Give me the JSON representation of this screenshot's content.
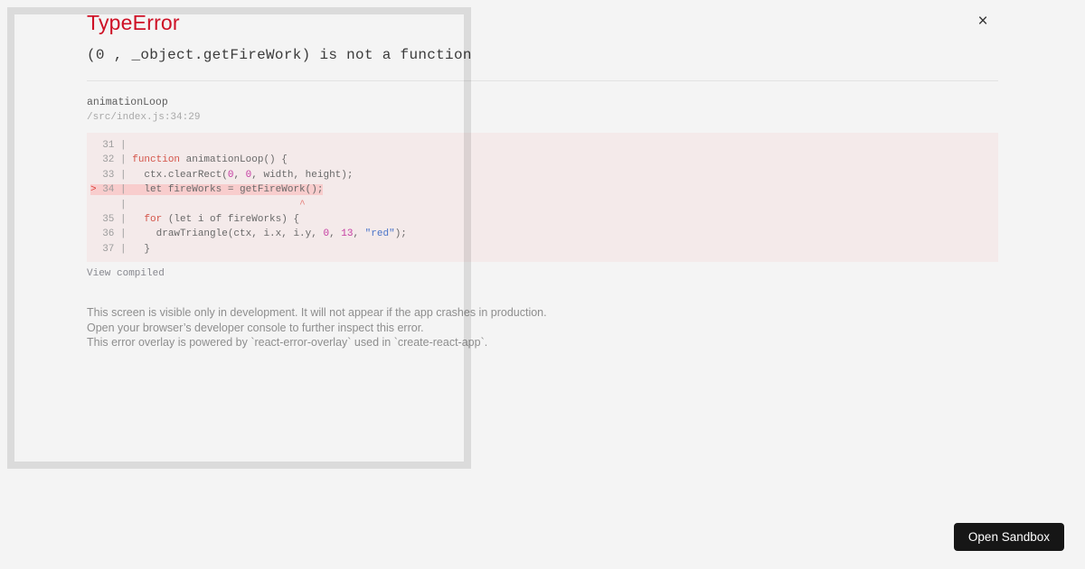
{
  "colors": {
    "page_bg": "#f4f4f4",
    "title_red": "#ce1126",
    "code_bg": "#f4eaea",
    "highlight_bg": "#f8cdcd",
    "keyword": "#d4554a",
    "number": "#c53ca2",
    "string": "#4a74c9",
    "button_bg": "#161616"
  },
  "overlay": {
    "title": "TypeError",
    "message": "(0 , _object.getFireWork) is not a function",
    "close_label": "×",
    "stack": {
      "function_name": "animationLoop",
      "file_location": "/src/index.js:34:29",
      "view_compiled": "View compiled"
    },
    "footer_lines": [
      "This screen is visible only in development. It will not appear if the app crashes in production.",
      "Open your browser’s developer console to further inspect this error.",
      "This error overlay is powered by `react-error-overlay` used in `create-react-app`."
    ]
  },
  "code_block": {
    "lines": [
      {
        "highlight": false,
        "tokens": [
          [
            "gutter",
            "  31 | "
          ]
        ]
      },
      {
        "highlight": false,
        "tokens": [
          [
            "gutter",
            "  32 | "
          ],
          [
            "keyword",
            "function"
          ],
          [
            "plain",
            " animationLoop() {"
          ]
        ]
      },
      {
        "highlight": false,
        "tokens": [
          [
            "gutter",
            "  33 | "
          ],
          [
            "plain",
            "  ctx.clearRect("
          ],
          [
            "number",
            "0"
          ],
          [
            "plain",
            ", "
          ],
          [
            "number",
            "0"
          ],
          [
            "plain",
            ", width, height);"
          ]
        ]
      },
      {
        "highlight": true,
        "tokens": [
          [
            "marker",
            "> "
          ],
          [
            "gutter",
            "34 | "
          ],
          [
            "plain",
            "  let fireWorks = getFireWork();"
          ]
        ]
      },
      {
        "highlight": false,
        "tokens": [
          [
            "gutter",
            "     | "
          ],
          [
            "plain",
            "                            "
          ],
          [
            "caret",
            "^"
          ]
        ]
      },
      {
        "highlight": false,
        "tokens": [
          [
            "gutter",
            "  35 | "
          ],
          [
            "plain",
            "  "
          ],
          [
            "keyword",
            "for"
          ],
          [
            "plain",
            " (let i of fireWorks) {"
          ]
        ]
      },
      {
        "highlight": false,
        "tokens": [
          [
            "gutter",
            "  36 | "
          ],
          [
            "plain",
            "    drawTriangle(ctx, i.x, i.y, "
          ],
          [
            "number",
            "0"
          ],
          [
            "plain",
            ", "
          ],
          [
            "number",
            "13"
          ],
          [
            "plain",
            ", "
          ],
          [
            "string",
            "\"red\""
          ],
          [
            "plain",
            ");"
          ]
        ]
      },
      {
        "highlight": false,
        "tokens": [
          [
            "gutter",
            "  37 | "
          ],
          [
            "plain",
            "  }"
          ]
        ]
      }
    ]
  },
  "sandbox": {
    "open_button_label": "Open Sandbox"
  }
}
